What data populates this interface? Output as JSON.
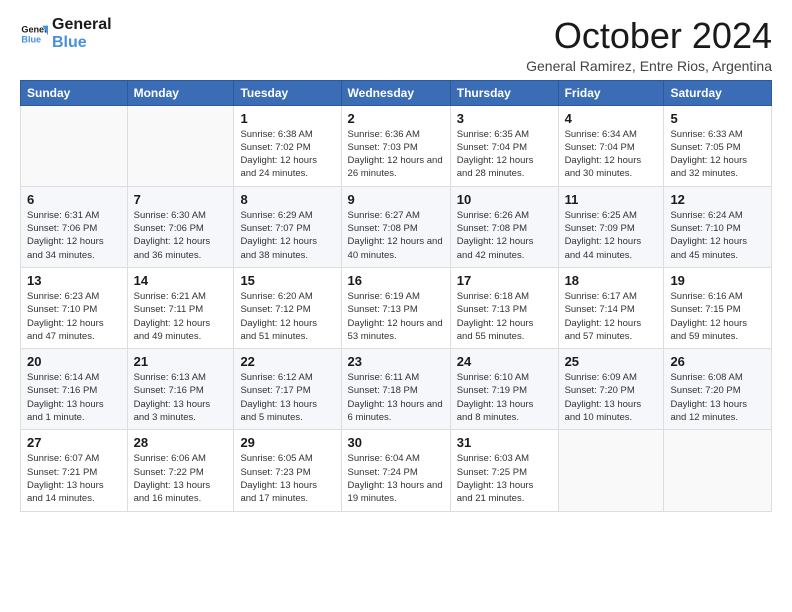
{
  "logo": {
    "line1": "General",
    "line2": "Blue"
  },
  "title": "October 2024",
  "location": "General Ramirez, Entre Rios, Argentina",
  "days_of_week": [
    "Sunday",
    "Monday",
    "Tuesday",
    "Wednesday",
    "Thursday",
    "Friday",
    "Saturday"
  ],
  "weeks": [
    [
      {
        "day": "",
        "info": ""
      },
      {
        "day": "",
        "info": ""
      },
      {
        "day": "1",
        "info": "Sunrise: 6:38 AM\nSunset: 7:02 PM\nDaylight: 12 hours and 24 minutes."
      },
      {
        "day": "2",
        "info": "Sunrise: 6:36 AM\nSunset: 7:03 PM\nDaylight: 12 hours and 26 minutes."
      },
      {
        "day": "3",
        "info": "Sunrise: 6:35 AM\nSunset: 7:04 PM\nDaylight: 12 hours and 28 minutes."
      },
      {
        "day": "4",
        "info": "Sunrise: 6:34 AM\nSunset: 7:04 PM\nDaylight: 12 hours and 30 minutes."
      },
      {
        "day": "5",
        "info": "Sunrise: 6:33 AM\nSunset: 7:05 PM\nDaylight: 12 hours and 32 minutes."
      }
    ],
    [
      {
        "day": "6",
        "info": "Sunrise: 6:31 AM\nSunset: 7:06 PM\nDaylight: 12 hours and 34 minutes."
      },
      {
        "day": "7",
        "info": "Sunrise: 6:30 AM\nSunset: 7:06 PM\nDaylight: 12 hours and 36 minutes."
      },
      {
        "day": "8",
        "info": "Sunrise: 6:29 AM\nSunset: 7:07 PM\nDaylight: 12 hours and 38 minutes."
      },
      {
        "day": "9",
        "info": "Sunrise: 6:27 AM\nSunset: 7:08 PM\nDaylight: 12 hours and 40 minutes."
      },
      {
        "day": "10",
        "info": "Sunrise: 6:26 AM\nSunset: 7:08 PM\nDaylight: 12 hours and 42 minutes."
      },
      {
        "day": "11",
        "info": "Sunrise: 6:25 AM\nSunset: 7:09 PM\nDaylight: 12 hours and 44 minutes."
      },
      {
        "day": "12",
        "info": "Sunrise: 6:24 AM\nSunset: 7:10 PM\nDaylight: 12 hours and 45 minutes."
      }
    ],
    [
      {
        "day": "13",
        "info": "Sunrise: 6:23 AM\nSunset: 7:10 PM\nDaylight: 12 hours and 47 minutes."
      },
      {
        "day": "14",
        "info": "Sunrise: 6:21 AM\nSunset: 7:11 PM\nDaylight: 12 hours and 49 minutes."
      },
      {
        "day": "15",
        "info": "Sunrise: 6:20 AM\nSunset: 7:12 PM\nDaylight: 12 hours and 51 minutes."
      },
      {
        "day": "16",
        "info": "Sunrise: 6:19 AM\nSunset: 7:13 PM\nDaylight: 12 hours and 53 minutes."
      },
      {
        "day": "17",
        "info": "Sunrise: 6:18 AM\nSunset: 7:13 PM\nDaylight: 12 hours and 55 minutes."
      },
      {
        "day": "18",
        "info": "Sunrise: 6:17 AM\nSunset: 7:14 PM\nDaylight: 12 hours and 57 minutes."
      },
      {
        "day": "19",
        "info": "Sunrise: 6:16 AM\nSunset: 7:15 PM\nDaylight: 12 hours and 59 minutes."
      }
    ],
    [
      {
        "day": "20",
        "info": "Sunrise: 6:14 AM\nSunset: 7:16 PM\nDaylight: 13 hours and 1 minute."
      },
      {
        "day": "21",
        "info": "Sunrise: 6:13 AM\nSunset: 7:16 PM\nDaylight: 13 hours and 3 minutes."
      },
      {
        "day": "22",
        "info": "Sunrise: 6:12 AM\nSunset: 7:17 PM\nDaylight: 13 hours and 5 minutes."
      },
      {
        "day": "23",
        "info": "Sunrise: 6:11 AM\nSunset: 7:18 PM\nDaylight: 13 hours and 6 minutes."
      },
      {
        "day": "24",
        "info": "Sunrise: 6:10 AM\nSunset: 7:19 PM\nDaylight: 13 hours and 8 minutes."
      },
      {
        "day": "25",
        "info": "Sunrise: 6:09 AM\nSunset: 7:20 PM\nDaylight: 13 hours and 10 minutes."
      },
      {
        "day": "26",
        "info": "Sunrise: 6:08 AM\nSunset: 7:20 PM\nDaylight: 13 hours and 12 minutes."
      }
    ],
    [
      {
        "day": "27",
        "info": "Sunrise: 6:07 AM\nSunset: 7:21 PM\nDaylight: 13 hours and 14 minutes."
      },
      {
        "day": "28",
        "info": "Sunrise: 6:06 AM\nSunset: 7:22 PM\nDaylight: 13 hours and 16 minutes."
      },
      {
        "day": "29",
        "info": "Sunrise: 6:05 AM\nSunset: 7:23 PM\nDaylight: 13 hours and 17 minutes."
      },
      {
        "day": "30",
        "info": "Sunrise: 6:04 AM\nSunset: 7:24 PM\nDaylight: 13 hours and 19 minutes."
      },
      {
        "day": "31",
        "info": "Sunrise: 6:03 AM\nSunset: 7:25 PM\nDaylight: 13 hours and 21 minutes."
      },
      {
        "day": "",
        "info": ""
      },
      {
        "day": "",
        "info": ""
      }
    ]
  ]
}
